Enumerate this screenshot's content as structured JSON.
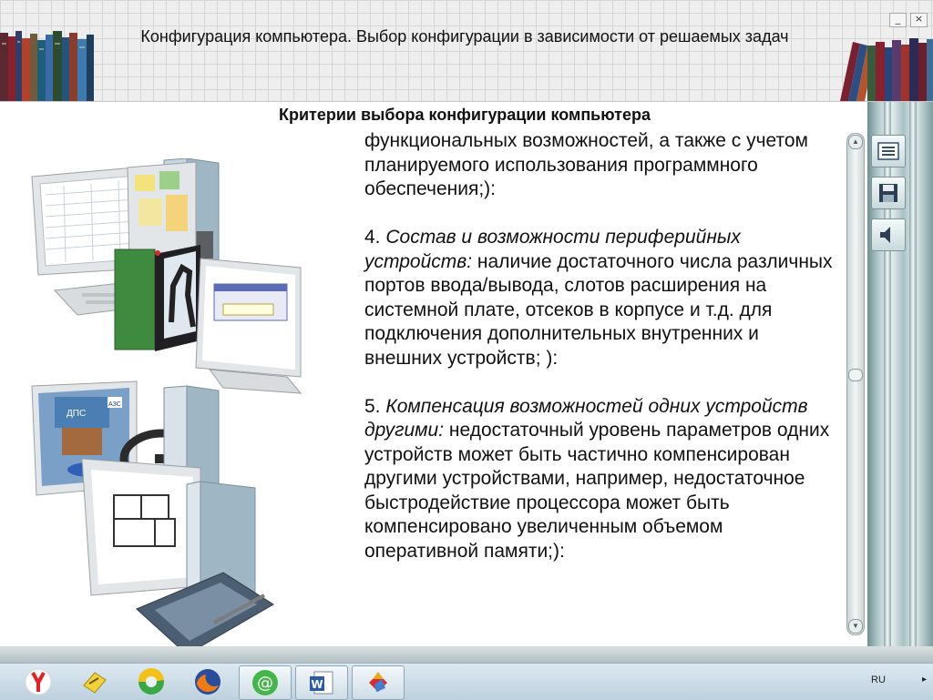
{
  "window": {
    "title": "Конфигурация компьютера. Выбор конфигурации в зависимости от решаемых задач",
    "buttons": {
      "minimize": "_",
      "close": "×"
    }
  },
  "content": {
    "section_title": "Критерии выбора конфигурации компьютера",
    "paragraphs": [
      {
        "plain": "функциональных возможностей, а также с учетом планируемого использования программного обеспечения;):"
      },
      {
        "number": "4. ",
        "italic": "Состав и возможности периферийных устройств:",
        "rest": " наличие достаточного числа различных портов ввода/вывода, слотов расширения на системной плате, отсеков в корпусе и т.д. для подключения дополнительных внутренних и внешних устройств; ):"
      },
      {
        "number": "5. ",
        "italic": "Компенсация возможностей одних устройств другими:",
        "rest": " недостаточный уровень параметров одних устройств может быть частично компенсирован другими устройствами, например, недостаточное быстродействие процессора может быть компенсировано увеличенным объемом оперативной памяти;):"
      }
    ],
    "illustration_labels": {
      "police": "ДПС",
      "sign": "АЗС"
    }
  },
  "scrollbar": {
    "up": "▲",
    "down": "▼"
  },
  "tools": [
    {
      "icon": "contents-list-icon"
    },
    {
      "icon": "save-disk-icon"
    },
    {
      "icon": "speaker-icon"
    }
  ],
  "taskbar": {
    "apps": [
      {
        "icon": "yandex-browser-icon"
      },
      {
        "icon": "file-manager-icon"
      },
      {
        "icon": "chrome-like-browser-icon"
      },
      {
        "icon": "firefox-icon"
      },
      {
        "icon": "mail-agent-icon"
      },
      {
        "icon": "word-icon"
      },
      {
        "icon": "presentation-app-icon"
      }
    ],
    "language": "RU",
    "tray_arrow": "▸"
  },
  "colors": {
    "accent_teal": "#8fb3b5",
    "taskbar_blue": "#c9dbe7"
  }
}
